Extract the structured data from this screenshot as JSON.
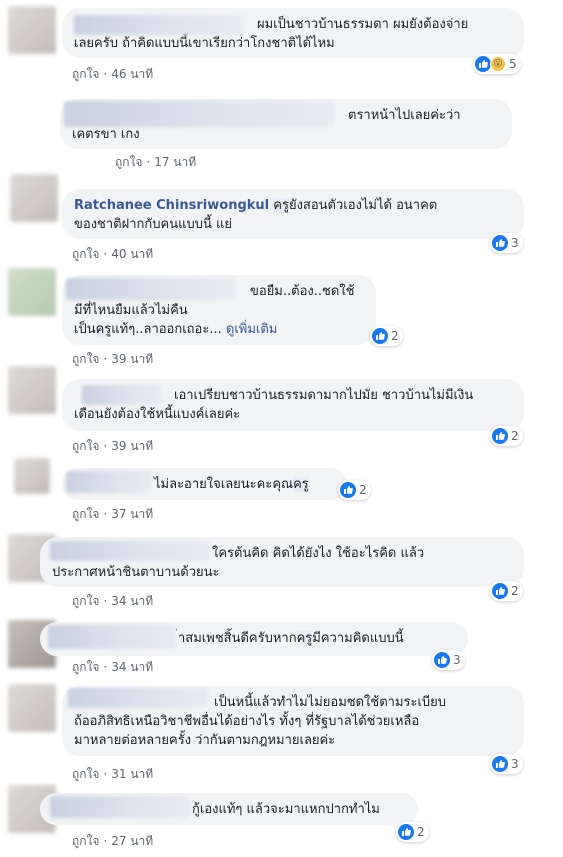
{
  "labels": {
    "like": "ถูกใจ",
    "see_more": "ดูเพิ่มเติม"
  },
  "colors": {
    "link": "#385898",
    "bubble": "#f2f3f5",
    "reaction": "#1877f2"
  },
  "comments": [
    {
      "line1": "ผมเป็นชาวบ้านธรรมดา ผมยังต้องจ่าย",
      "line2": "เลยครับ ถ้าคิดแบบนี้เขาเรียกว่าโกงชาติได้ไหม",
      "time": "46 นาที",
      "reactions": "5",
      "icons": [
        "like-icon",
        "wow-icon"
      ]
    },
    {
      "line1": "ตราหน้าไปเลยค่ะว่า",
      "line2": "เคตรขา เกง",
      "time": "17 นาที"
    },
    {
      "name": "Ratchanee Chinsriwongkul",
      "mention": "ครู",
      "line1_rest": "ยังสอนตัวเองไม่ได้ อนาคต",
      "line2": "ของชาติฝากกับคนแบบนี้ แย่",
      "time": "40 นาที",
      "reactions": "3"
    },
    {
      "line1": "ขอยืม..ต้อง..ชดใช้",
      "line2": "มีที่ไหนยืมแล้วไม่คืน",
      "line3_pre": "เป็น",
      "mention": "ครู",
      "line3_post": "แท้ๆ..ลาออกเถอะ... ",
      "time": "39 นาที",
      "reactions": "2"
    },
    {
      "line1": "เอาเปรียบชาวบ้านธรรมดามากไปมัย ชาวบ้านไม่มีเงิน",
      "line2": "เดือนยังต้องใช้หนี้แบงค์เลยค่ะ",
      "time": "39 นาที",
      "reactions": "2"
    },
    {
      "line1": "ไม่ละอายใจเลยนะคะคุณ",
      "mention": "ครู",
      "time": "37 นาที",
      "reactions": "2"
    },
    {
      "line1": "ใครต้นคิด คิดได้ยังไง ใช้อะไรคิด แล้ว",
      "line2": "ประกาศหน้าชินตาบานด้วยนะ",
      "time": "34 นาที",
      "reactions": "2"
    },
    {
      "line1_pre": "่าสมเพชสิ้นดีครับหาก",
      "mention": "ครู",
      "line1_post": "มีความคิดแบบนี้",
      "time": "34 นาที",
      "reactions": "3"
    },
    {
      "line1": "เป็นหนี้แล้วทำไมไม่ยอมชดใช้ตามระเบียบ",
      "line2": "ถ้ออภิสิทธิเหนือวิชาชีพอื่นได้อย่างไร ทั้งๆ ที่รัฐบาลได้ช่วยเหลือ",
      "line3": "มาหลายต่อหลายครั้ง ว่ากันตามกฎหมายเลยค่ะ",
      "time": "31 นาที",
      "reactions": "3"
    },
    {
      "line1": "กู้เองแท้ๆ แล้วจะมาแหกปากทำไม",
      "time": "27 นาที",
      "reactions": "2"
    }
  ]
}
